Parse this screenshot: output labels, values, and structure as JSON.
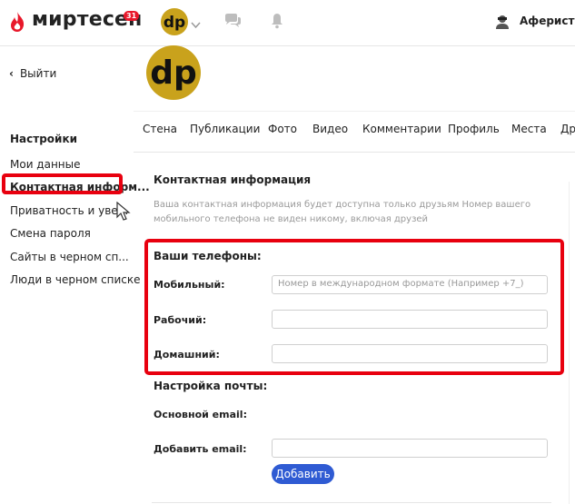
{
  "header": {
    "logo_text": "миртесен",
    "logo_badge": "31",
    "user_name": "Аферисты н",
    "brand_color": "#e8182a"
  },
  "sidebar": {
    "back_label": "Выйти",
    "title": "Настройки",
    "items": [
      {
        "label": "Мои данные"
      },
      {
        "label": "Контактная информ..."
      },
      {
        "label": "Приватность и уве..."
      },
      {
        "label": "Смена пароля"
      },
      {
        "label": "Сайты в черном сп..."
      },
      {
        "label": "Люди в черном списке"
      }
    ]
  },
  "tabs": [
    "Стена",
    "Публикации",
    "Фото",
    "Видео",
    "Комментарии",
    "Профиль",
    "Места",
    "Дру"
  ],
  "contact": {
    "title": "Контактная информация",
    "description": "Ваша контактная информация будет доступна только друзьям Номер вашего мобильного телефона не виден никому, включая друзей",
    "phones_title": "Ваши телефоны:",
    "mobile_label": "Мобильный:",
    "mobile_placeholder": "Номер в международном формате (Например +7_)",
    "work_label": "Рабочий:",
    "home_label": "Домашний:",
    "mail_title": "Настройка почты:",
    "primary_email_label": "Основной email:",
    "add_email_label": "Добавить email:",
    "add_button": "Добавить"
  }
}
